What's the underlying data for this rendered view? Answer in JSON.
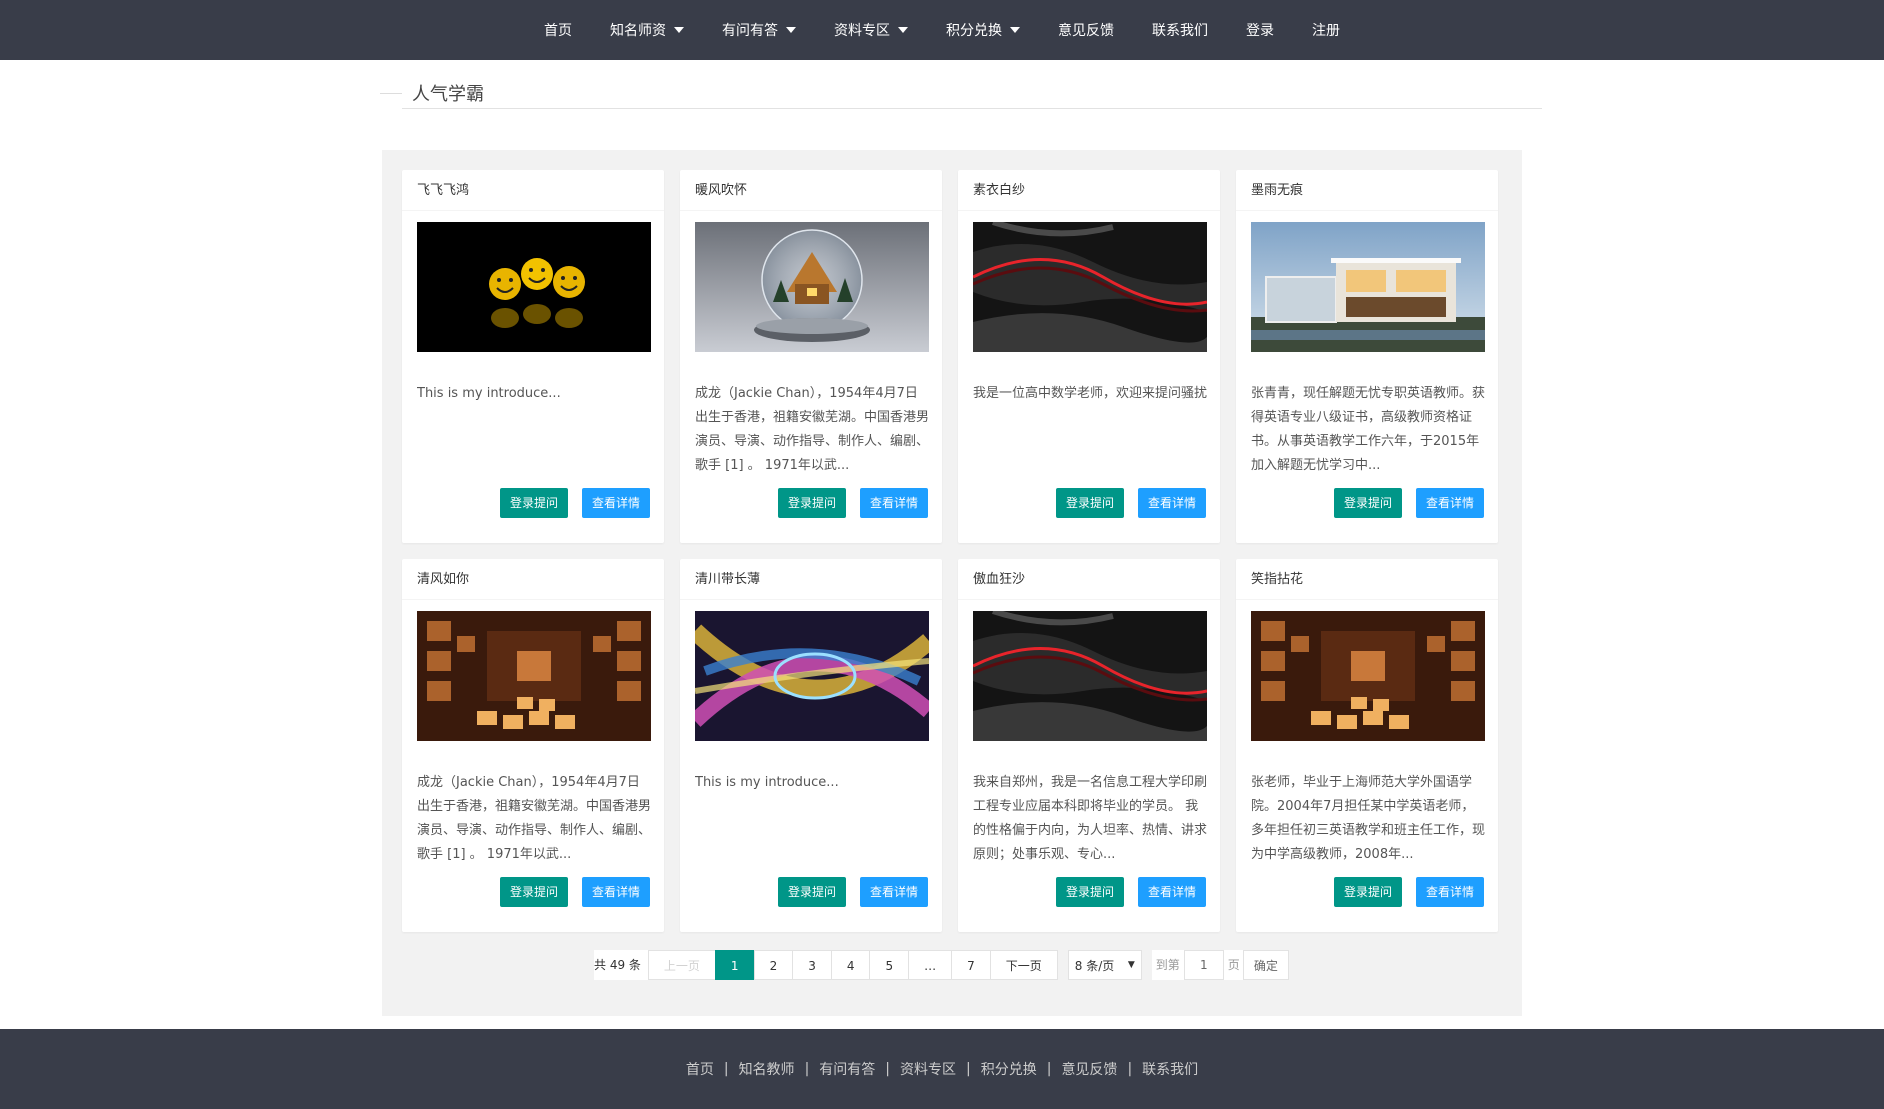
{
  "nav": {
    "items": [
      {
        "label": "首页",
        "dropdown": false
      },
      {
        "label": "知名师资",
        "dropdown": true
      },
      {
        "label": "有问有答",
        "dropdown": true
      },
      {
        "label": "资料专区",
        "dropdown": true
      },
      {
        "label": "积分兑换",
        "dropdown": true
      },
      {
        "label": "意见反馈",
        "dropdown": false
      },
      {
        "label": "联系我们",
        "dropdown": false
      },
      {
        "label": "登录",
        "dropdown": false
      },
      {
        "label": "注册",
        "dropdown": false
      }
    ]
  },
  "section": {
    "title": "人气学霸"
  },
  "cards": [
    {
      "name": "飞飞飞鸿",
      "image": "smiley-faces",
      "desc": "This is my introduce...",
      "ask_label": "登录提问",
      "detail_label": "查看详情"
    },
    {
      "name": "暖风吹怀",
      "image": "snow-globe",
      "desc": "成龙（Jackie Chan），1954年4月7日出生于香港，祖籍安徽芜湖。中国香港男演员、导演、动作指导、制作人、编剧、歌手 [1] 。 1971年以武...",
      "ask_label": "登录提问",
      "detail_label": "查看详情"
    },
    {
      "name": "素衣白纱",
      "image": "dark-red-waves",
      "desc": "我是一位高中数学老师，欢迎来提问骚扰",
      "ask_label": "登录提问",
      "detail_label": "查看详情"
    },
    {
      "name": "墨雨无痕",
      "image": "modern-house",
      "desc": "张青青，现任解题无忧专职英语教师。获得英语专业八级证书，高级教师资格证书。从事英语教学工作六年，于2015年加入解题无忧学习中...",
      "ask_label": "登录提问",
      "detail_label": "查看详情"
    },
    {
      "name": "清风如你",
      "image": "orange-cubes",
      "desc": "成龙（Jackie Chan），1954年4月7日出生于香港，祖籍安徽芜湖。中国香港男演员、导演、动作指导、制作人、编剧、歌手 [1] 。 1971年以武...",
      "ask_label": "登录提问",
      "detail_label": "查看详情"
    },
    {
      "name": "清川带长薄",
      "image": "colorful-swirl",
      "desc": "This is my introduce...",
      "ask_label": "登录提问",
      "detail_label": "查看详情"
    },
    {
      "name": "傲血狂沙",
      "image": "dark-red-waves",
      "desc": "我来自郑州，我是一名信息工程大学印刷工程专业应届本科即将毕业的学员。 我的性格偏于内向，为人坦率、热情、讲求原则；处事乐观、专心...",
      "ask_label": "登录提问",
      "detail_label": "查看详情"
    },
    {
      "name": "笑指拈花",
      "image": "orange-cubes",
      "desc": "张老师，毕业于上海师范大学外国语学院。2004年7月担任某中学英语老师，多年担任初三英语教学和班主任工作，现为中学高级教师，2008年...",
      "ask_label": "登录提问",
      "detail_label": "查看详情"
    }
  ],
  "pager": {
    "count": "共 49 条",
    "prev": "上一页",
    "pages": [
      "1",
      "2",
      "3",
      "4",
      "5",
      "…",
      "7"
    ],
    "current": "1",
    "next": "下一页",
    "limit": "8 条/页",
    "limit_arrow": "▼",
    "goto_label": "到第",
    "goto_value": "1",
    "page_label": "页",
    "confirm": "确定"
  },
  "footer": {
    "links": [
      "首页",
      "知名教师",
      "有问有答",
      "资料专区",
      "积分兑换",
      "意见反馈",
      "联系我们"
    ],
    "separator": "|"
  },
  "colors": {
    "nav_bg": "#393d49",
    "primary_green": "#009688",
    "primary_blue": "#1e9fff",
    "panel_bg": "#f2f2f2"
  }
}
